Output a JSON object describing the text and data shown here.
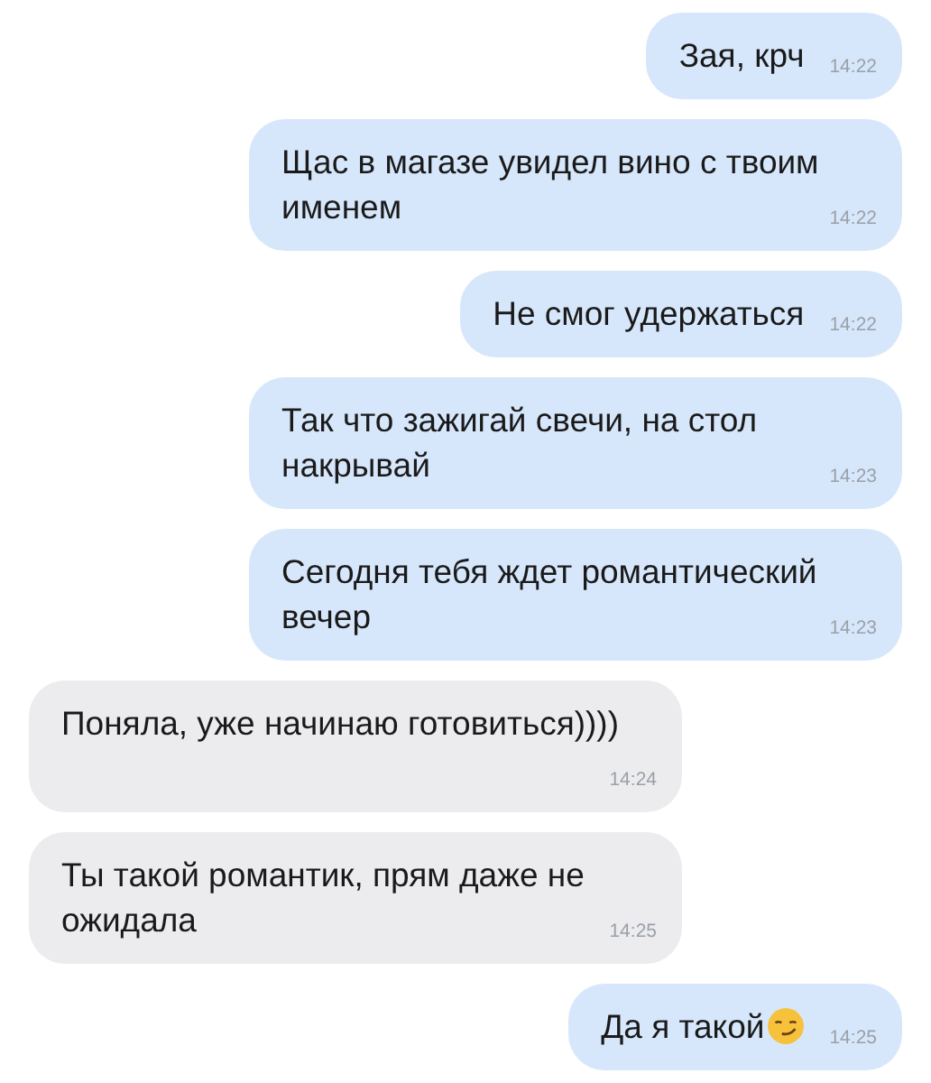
{
  "messages": [
    {
      "kind": "outgoing",
      "text": "Зая, крч",
      "time": "14:22"
    },
    {
      "kind": "outgoing",
      "text": "Щас в магазе увидел вино с твоим именем",
      "time": "14:22"
    },
    {
      "kind": "outgoing",
      "text": "Не смог удержаться",
      "time": "14:22"
    },
    {
      "kind": "outgoing",
      "text": "Так что зажигай свечи, на стол накрывай",
      "time": "14:23"
    },
    {
      "kind": "outgoing",
      "text": "Сегодня тебя ждет романтический вечер",
      "time": "14:23"
    },
    {
      "kind": "incoming",
      "text": "Поняла, уже начинаю готовиться))))",
      "time": "14:24"
    },
    {
      "kind": "incoming",
      "text": "Ты такой романтик, прям даже не ожидала",
      "time": "14:25"
    },
    {
      "kind": "outgoing",
      "text": "Да я такой",
      "trailing_icon": {
        "kind": "smirk"
      },
      "time": "14:25"
    }
  ]
}
